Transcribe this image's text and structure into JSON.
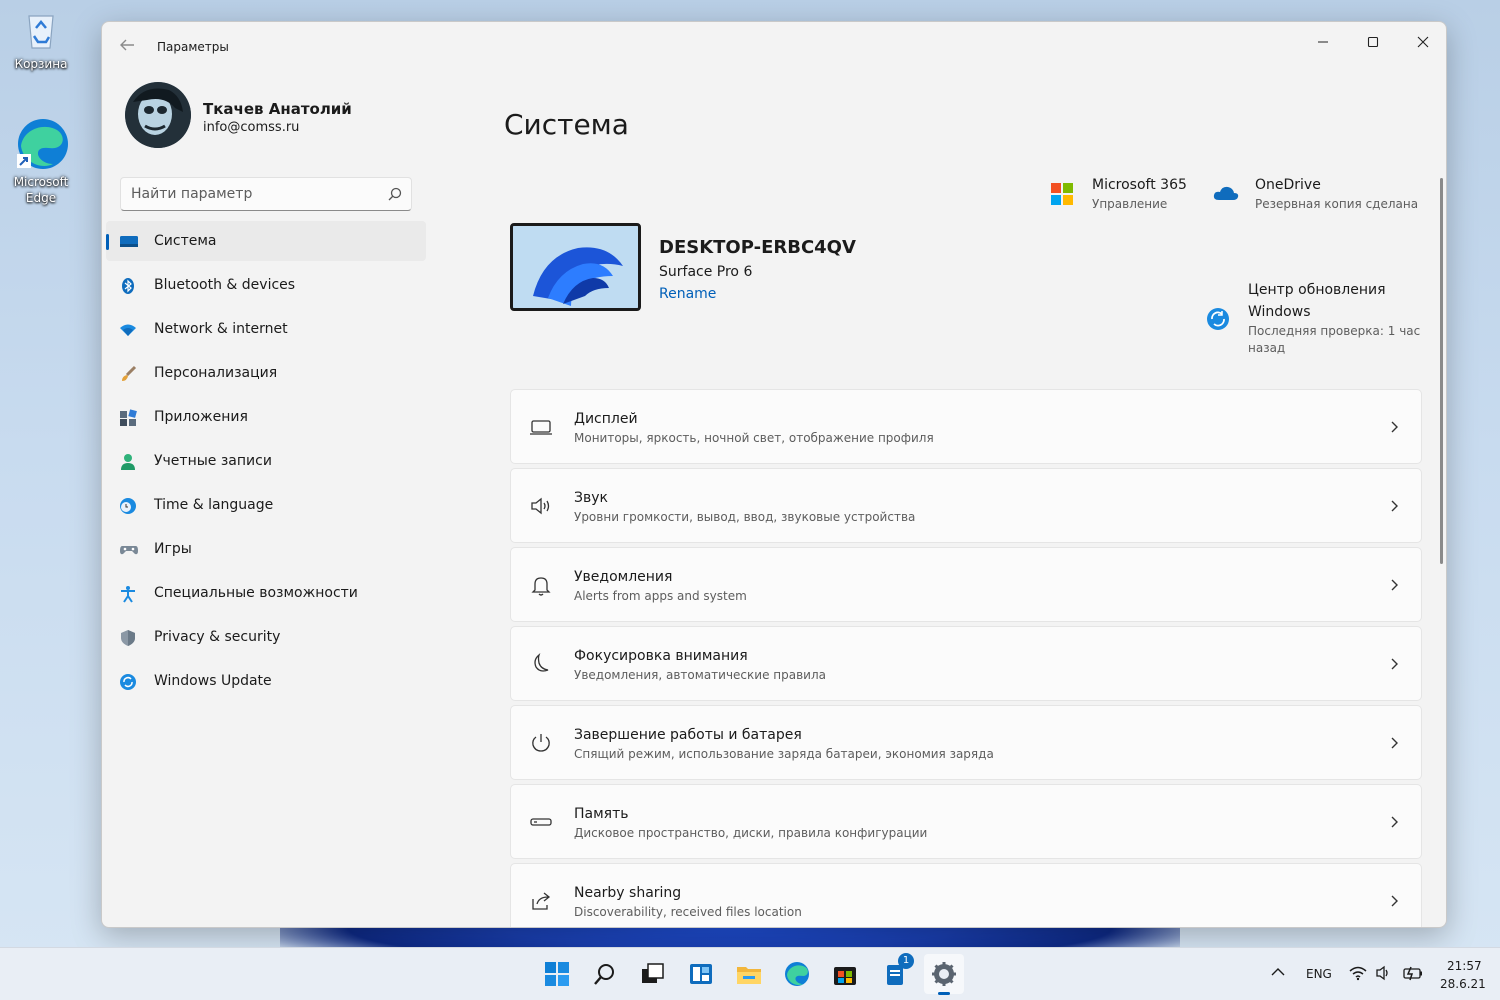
{
  "desktop": {
    "icons": [
      {
        "label": "Корзина"
      },
      {
        "label": "Microsoft Edge"
      }
    ]
  },
  "window": {
    "title": "Параметры",
    "controls": {
      "minimize": "—",
      "maximize": "☐",
      "close": "✕"
    }
  },
  "profile": {
    "name": "Ткачев Анатолий",
    "email": "info@comss.ru"
  },
  "search": {
    "placeholder": "Найти параметр"
  },
  "sidebar": {
    "items": [
      {
        "label": "Система",
        "icon": "system-icon",
        "active": true
      },
      {
        "label": "Bluetooth & devices",
        "icon": "bluetooth-icon"
      },
      {
        "label": "Network & internet",
        "icon": "wifi-icon"
      },
      {
        "label": "Персонализация",
        "icon": "brush-icon"
      },
      {
        "label": "Приложения",
        "icon": "apps-icon"
      },
      {
        "label": "Учетные записи",
        "icon": "person-icon"
      },
      {
        "label": "Time & language",
        "icon": "clock-globe-icon"
      },
      {
        "label": "Игры",
        "icon": "gamepad-icon"
      },
      {
        "label": "Специальные возможности",
        "icon": "accessibility-icon"
      },
      {
        "label": "Privacy & security",
        "icon": "shield-icon"
      },
      {
        "label": "Windows Update",
        "icon": "update-icon"
      }
    ]
  },
  "main": {
    "title": "Система",
    "device": {
      "name": "DESKTOP-ERBC4QV",
      "model": "Surface Pro 6",
      "rename": "Rename"
    },
    "quick": {
      "m365": {
        "title": "Microsoft 365",
        "sub": "Управление"
      },
      "onedrive": {
        "title": "OneDrive",
        "sub": "Резервная копия сделана"
      },
      "update": {
        "title_line1": "Центр обновления",
        "title_line2": "Windows",
        "sub_line1": "Последняя проверка: 1 час",
        "sub_line2": "назад"
      }
    },
    "cards": [
      {
        "title": "Дисплей",
        "sub": "Мониторы, яркость, ночной свет, отображение профиля",
        "icon": "display-icon"
      },
      {
        "title": "Звук",
        "sub": "Уровни громкости, вывод, ввод, звуковые устройства",
        "icon": "speaker-icon"
      },
      {
        "title": "Уведомления",
        "sub": "Alerts from apps and system",
        "icon": "bell-icon"
      },
      {
        "title": "Фокусировка внимания",
        "sub": "Уведомления, автоматические правила",
        "icon": "moon-icon"
      },
      {
        "title": "Завершение работы и батарея",
        "sub": "Спящий режим, использование заряда батареи, экономия заряда",
        "icon": "power-icon"
      },
      {
        "title": "Память",
        "sub": "Дисковое пространство, диски, правила конфигурации",
        "icon": "storage-icon"
      },
      {
        "title": "Nearby sharing",
        "sub": "Discoverability, received files location",
        "icon": "share-icon"
      }
    ]
  },
  "taskbar": {
    "store_badge": "1",
    "tray": {
      "lang": "ENG",
      "time": "21:57",
      "date": "28.6.21"
    }
  },
  "colors": {
    "accent": "#005fb8",
    "window_bg": "#f3f3f3",
    "card_bg": "#fbfbfb"
  }
}
